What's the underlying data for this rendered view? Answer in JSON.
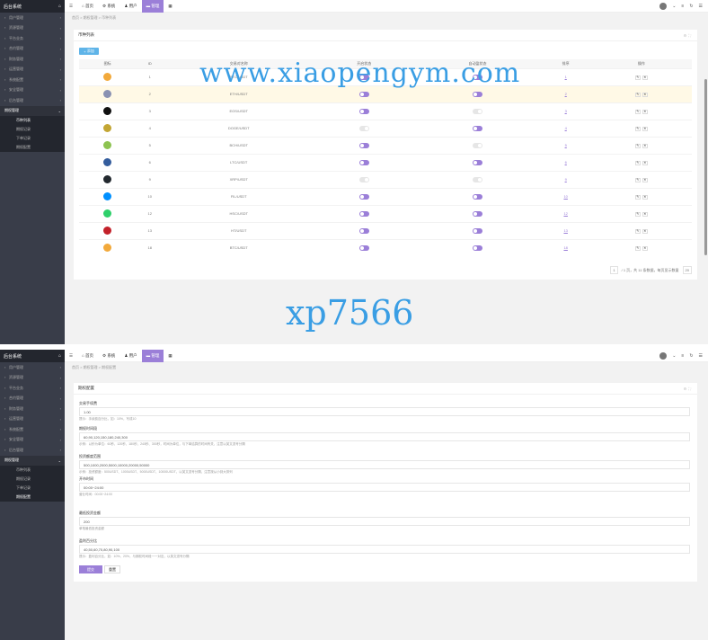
{
  "app_title": "后台系统",
  "home_icon": "home-icon",
  "sidebar": {
    "items": [
      {
        "label": "用户管理"
      },
      {
        "label": "资源管理"
      },
      {
        "label": "平台业务"
      },
      {
        "label": "合约管理"
      },
      {
        "label": "财务管理"
      },
      {
        "label": "运营管理"
      },
      {
        "label": "系统配置"
      },
      {
        "label": "安全管理"
      },
      {
        "label": "后台管理"
      }
    ],
    "open_group": "期权管理",
    "sub_items": [
      {
        "label": "币种列表"
      },
      {
        "label": "期权记录"
      },
      {
        "label": "下单记录"
      },
      {
        "label": "期权配置"
      }
    ]
  },
  "topbar": {
    "items": [
      {
        "label": "首页"
      },
      {
        "label": "系统"
      },
      {
        "label": "用户"
      },
      {
        "label": "管理"
      }
    ]
  },
  "panel1": {
    "breadcrumb": "首页 > 期权管理 > 币种列表",
    "card_title": "币种列表",
    "add_button": "添加",
    "columns": [
      "图标",
      "ID",
      "交易对名称",
      "开启状态",
      "自动盈状态",
      "排序",
      "操作"
    ],
    "rows": [
      {
        "id": "1",
        "pair": "BTC/USDT",
        "open": "on",
        "auto": "on",
        "sort": "1",
        "color": "#f2a93b"
      },
      {
        "id": "2",
        "pair": "ETH/USDT",
        "open": "on",
        "auto": "on",
        "sort": "2",
        "color": "#8a92b2"
      },
      {
        "id": "3",
        "pair": "EOS/USDT",
        "open": "on",
        "auto": "off",
        "sort": "3",
        "color": "#111111"
      },
      {
        "id": "4",
        "pair": "DOGE/USDT",
        "open": "off",
        "auto": "on",
        "sort": "4",
        "color": "#c3a634"
      },
      {
        "id": "5",
        "pair": "BCH/USDT",
        "open": "on",
        "auto": "off",
        "sort": "5",
        "color": "#8dc351"
      },
      {
        "id": "6",
        "pair": "LTC/USDT",
        "open": "on",
        "auto": "on",
        "sort": "6",
        "color": "#345d9d"
      },
      {
        "id": "9",
        "pair": "XRP/USDT",
        "open": "off",
        "auto": "off",
        "sort": "9",
        "color": "#23292f"
      },
      {
        "id": "10",
        "pair": "FIL/USDT",
        "open": "on",
        "auto": "on",
        "sort": "10",
        "color": "#0090ff"
      },
      {
        "id": "12",
        "pair": "HSC/USDT",
        "open": "on",
        "auto": "on",
        "sort": "12",
        "color": "#2fd06b"
      },
      {
        "id": "13",
        "pair": "HT/USDT",
        "open": "on",
        "auto": "on",
        "sort": "13",
        "color": "#c3212a"
      },
      {
        "id": "18",
        "pair": "BTC/USDT",
        "open": "on",
        "auto": "on",
        "sort": "18",
        "color": "#f2a93b"
      }
    ],
    "pager": {
      "page": "1",
      "summary": "/ 1 页，共 11 条数据，每页显示数量",
      "per_page": "20"
    }
  },
  "watermark": {
    "url": "www.xiaopengym.com",
    "code": "xp7566"
  },
  "panel2": {
    "breadcrumb": "首页 > 期权管理 > 期权配置",
    "card_title": "期权配置",
    "fields": [
      {
        "label": "交易手续费",
        "value": "1.00",
        "help": "提示：手续费百分比，如：10%，写成10"
      },
      {
        "label": "期权时间段",
        "value": "60,90,120,150,180,240,300",
        "help": "示例：以秒为单位：60秒、120秒、180秒、240秒、300秒，时间为单位，与下单结算的时间有关，注意以英文逗号分隔"
      },
      {
        "label": "投资额度范围",
        "value": "500,1000,2000,5000,10000,20000,50000",
        "help": "示例：投资额度：500USDT、1000USDT、5000USDT、10000USDT，以英文逗号分隔，注意按从小到大排列"
      },
      {
        "label": "开市时间",
        "value": "00:00~24:00",
        "help": "营业时间：00:00~24:00"
      },
      {
        "label": "最低投资金额",
        "value": "200",
        "help": "单笔最低投资金额"
      },
      {
        "label": "盈利百分比",
        "value": "40,50,60,70,80,90,100",
        "help": "提示：盈利百分比，如：10%、20%，与期权时间段一一对应，以英文逗号分隔"
      }
    ],
    "submit": "提交",
    "reset": "重置"
  }
}
